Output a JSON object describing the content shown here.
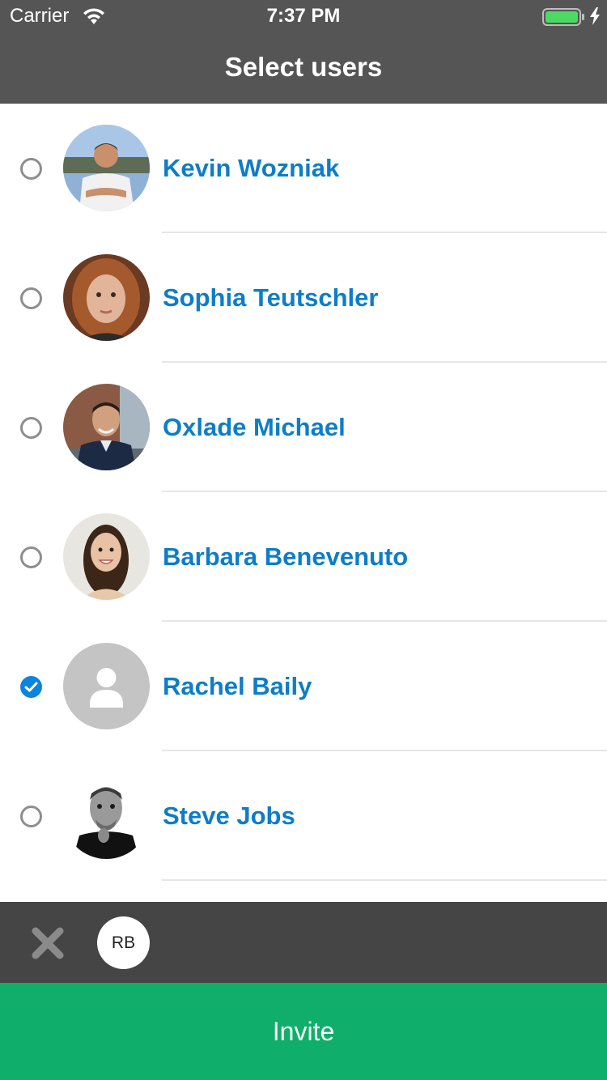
{
  "status_bar": {
    "carrier": "Carrier",
    "time": "7:37 PM",
    "battery_color": "#4cd964"
  },
  "nav": {
    "title": "Select users"
  },
  "users": [
    {
      "name": "Kevin Wozniak",
      "selected": false,
      "avatar": "photo"
    },
    {
      "name": "Sophia Teutschler",
      "selected": false,
      "avatar": "photo"
    },
    {
      "name": "Oxlade Michael",
      "selected": false,
      "avatar": "photo"
    },
    {
      "name": "Barbara Benevenuto",
      "selected": false,
      "avatar": "photo"
    },
    {
      "name": "Rachel Baily",
      "selected": true,
      "avatar": "placeholder-person-icon"
    },
    {
      "name": "Steve Jobs",
      "selected": false,
      "avatar": "photo"
    }
  ],
  "selection_bar": {
    "clear_icon": "close-icon",
    "chips": [
      {
        "initials": "RB"
      }
    ]
  },
  "invite": {
    "label": "Invite"
  },
  "colors": {
    "header": "#555555",
    "name_text": "#0d7dc8",
    "checked": "#0a84e0",
    "selection_bar": "#454545",
    "invite_button": "#0fae6a"
  }
}
